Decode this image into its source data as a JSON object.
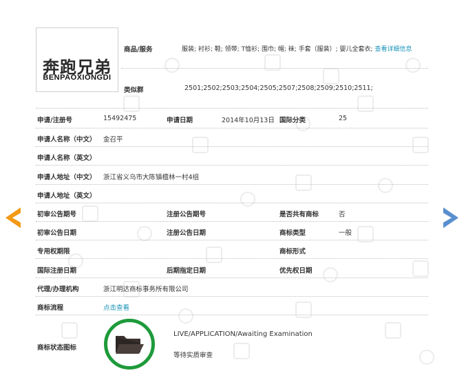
{
  "logo": {
    "cn": "奔跑兄弟",
    "en": "BENPAOXIONGDI"
  },
  "goods": {
    "label": "商品/服务",
    "value": "服装; 衬衫; 鞋; 领带; T恤衫; 围巾; 帽; 袜; 手套（服装）; 婴儿全套衣;",
    "link": "查看详细信息"
  },
  "similar": {
    "label": "类似群",
    "value": "2501;2502;2503;2504;2505;2507;2508;2509;2510;2511;"
  },
  "rows": {
    "reg_no": {
      "label": "申请/注册号",
      "value": "15492475"
    },
    "app_date": {
      "label": "申请日期",
      "value": "2014年10月13日"
    },
    "intl_class": {
      "label": "国际分类",
      "value": "25"
    },
    "applicant_cn": {
      "label": "申请人名称（中文）",
      "value": "金召平"
    },
    "applicant_en": {
      "label": "申请人名称（英文）",
      "value": ""
    },
    "address_cn": {
      "label": "申请人地址（中文）",
      "value": "浙江省义乌市大陈镇檀林一村4组"
    },
    "address_en": {
      "label": "申请人地址（英文）",
      "value": ""
    },
    "prelim_no": {
      "label": "初审公告期号",
      "value": ""
    },
    "reg_pub_no": {
      "label": "注册公告期号",
      "value": ""
    },
    "shared": {
      "label": "是否共有商标",
      "value": "否"
    },
    "prelim_date": {
      "label": "初审公告日期",
      "value": ""
    },
    "reg_pub_date": {
      "label": "注册公告日期",
      "value": ""
    },
    "tm_type": {
      "label": "商标类型",
      "value": "一般"
    },
    "exclusive": {
      "label": "专用权期限",
      "value": ""
    },
    "tm_form": {
      "label": "商标形式",
      "value": ""
    },
    "intl_reg_date": {
      "label": "国际注册日期",
      "value": ""
    },
    "later_date": {
      "label": "后期指定日期",
      "value": ""
    },
    "priority_date": {
      "label": "优先权日期",
      "value": ""
    },
    "agent": {
      "label": "代理/办理机构",
      "value": "浙江明达商标事务所有限公司"
    },
    "flow": {
      "label": "商标流程",
      "link": "点击查看"
    },
    "status": {
      "label": "商标状态图标",
      "en": "LIVE/APPLICATION/Awaiting Examination",
      "cn": "等待实质审查"
    }
  },
  "colors": {
    "prev_arrow": "#f29a16",
    "next_arrow": "#5a8fcf",
    "status_ring": "#1e9a3a",
    "link": "#1a93b8"
  },
  "icons": {
    "prev": "chevron-left-icon",
    "next": "chevron-right-icon",
    "status": "folder-open-icon"
  }
}
